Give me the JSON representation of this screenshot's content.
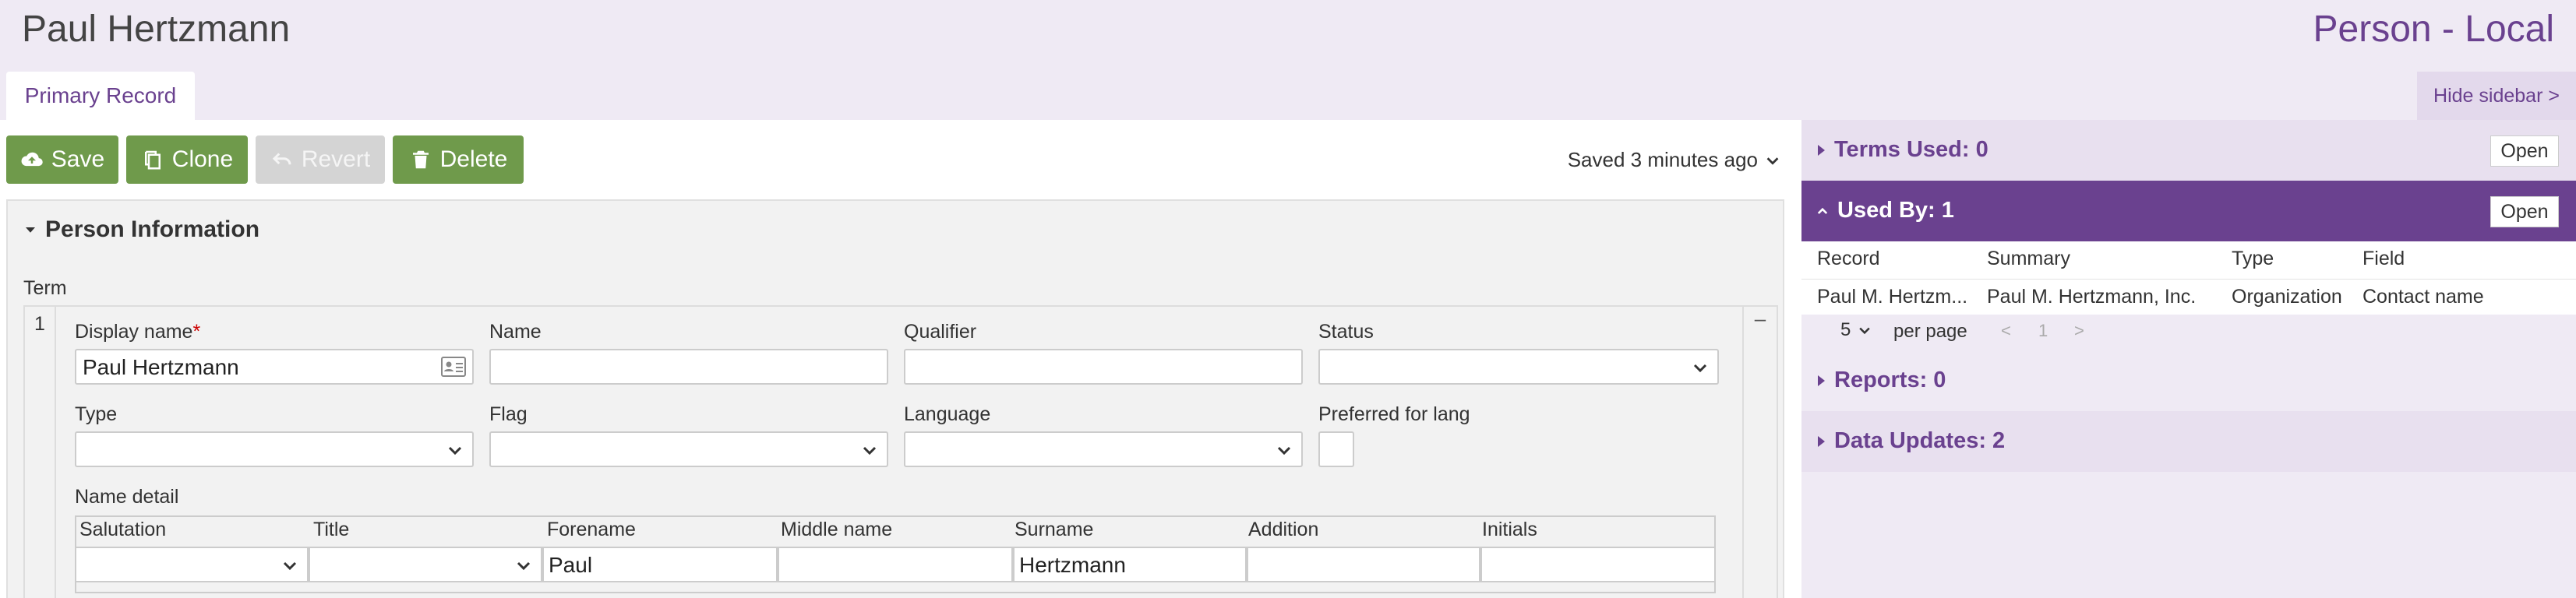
{
  "header": {
    "title": "Paul Hertzmann",
    "record_type": "Person - Local"
  },
  "tabs": {
    "primary": "Primary Record",
    "hide_sidebar": "Hide sidebar >"
  },
  "toolbar": {
    "save": "Save",
    "clone": "Clone",
    "revert": "Revert",
    "delete": "Delete",
    "saved_status": "Saved 3 minutes ago"
  },
  "panel": {
    "title": "Person Information",
    "term_label": "Term",
    "term_index": "1",
    "term_remove": "–",
    "fields": {
      "display_name_label": "Display name",
      "display_name_required": "*",
      "display_name_value": "Paul Hertzmann",
      "name_label": "Name",
      "qualifier_label": "Qualifier",
      "status_label": "Status",
      "type_label": "Type",
      "flag_label": "Flag",
      "language_label": "Language",
      "preferred_label": "Preferred for lang"
    },
    "name_detail": {
      "label": "Name detail",
      "columns": [
        "Salutation",
        "Title",
        "Forename",
        "Middle name",
        "Surname",
        "Addition",
        "Initials"
      ],
      "values": [
        "",
        "",
        "Paul",
        "",
        "Hertzmann",
        "",
        ""
      ]
    }
  },
  "sidebar": {
    "terms_used": "Terms Used: 0",
    "used_by": "Used By: 1",
    "open": "Open",
    "table": {
      "headers": [
        "Record",
        "Summary",
        "Type",
        "Field"
      ],
      "row": [
        "Paul M. Hertzm...",
        "Paul M. Hertzmann, Inc.",
        "Organization",
        "Contact name"
      ]
    },
    "pager": {
      "per_page_value": "5",
      "per_page_label": "per page",
      "prev": "<",
      "page": "1",
      "next": ">"
    },
    "reports": "Reports: 0",
    "data_updates": "Data Updates: 2"
  },
  "colors": {
    "accent": "#6a418f",
    "button_green": "#6f9a4b",
    "header_bg": "#efeaf4"
  },
  "icons": [
    "cloud-upload-icon",
    "copy-icon",
    "undo-icon",
    "trash-icon",
    "chevron-down-icon",
    "id-card-icon",
    "caret-right-icon",
    "caret-down-icon",
    "chevron-up-icon"
  ]
}
